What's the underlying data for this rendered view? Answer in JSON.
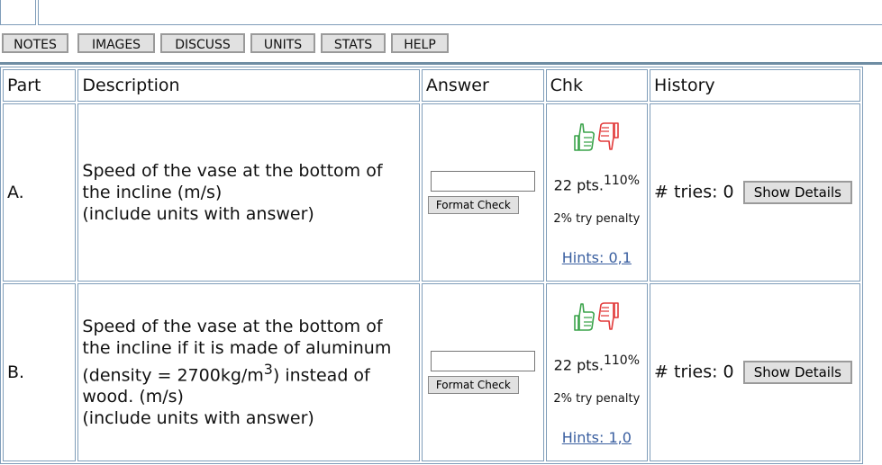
{
  "toolbar": {
    "notes": "NOTES",
    "images": "IMAGES",
    "discuss": "DISCUSS",
    "units": "UNITS",
    "stats": "STATS",
    "help": "HELP"
  },
  "table": {
    "headers": {
      "part": "Part",
      "description": "Description",
      "answer": "Answer",
      "chk": "Chk",
      "history": "History"
    },
    "rows": [
      {
        "part": "A.",
        "description_lines": [
          "Speed of the vase at the bottom of",
          "the incline (m/s)",
          "(include units with answer)"
        ],
        "answer_value": "",
        "format_check": "Format Check",
        "points": "22 pts.",
        "percent": "110%",
        "penalty": "2% try penalty",
        "hints": "Hints: 0,1",
        "tries": "# tries: 0",
        "show_details": "Show Details"
      },
      {
        "part": "B.",
        "description_lines": [
          "Speed of the vase at the bottom of",
          "the incline if it is made of aluminum",
          "(density = 2700kg/m",
          "3",
          ") instead of",
          "wood. (m/s)",
          "(include units with answer)"
        ],
        "answer_value": "",
        "format_check": "Format Check",
        "points": "22 pts.",
        "percent": "110%",
        "penalty": "2% try penalty",
        "hints": "Hints: 1,0",
        "tries": "# tries: 0",
        "show_details": "Show Details"
      }
    ]
  },
  "colors": {
    "thumb_up": "#3aa34a",
    "thumb_down": "#e23b3b",
    "border": "#7f9db9",
    "link": "#3a5fa0"
  },
  "icons": [
    "thumbs-up-icon",
    "thumbs-down-icon"
  ]
}
